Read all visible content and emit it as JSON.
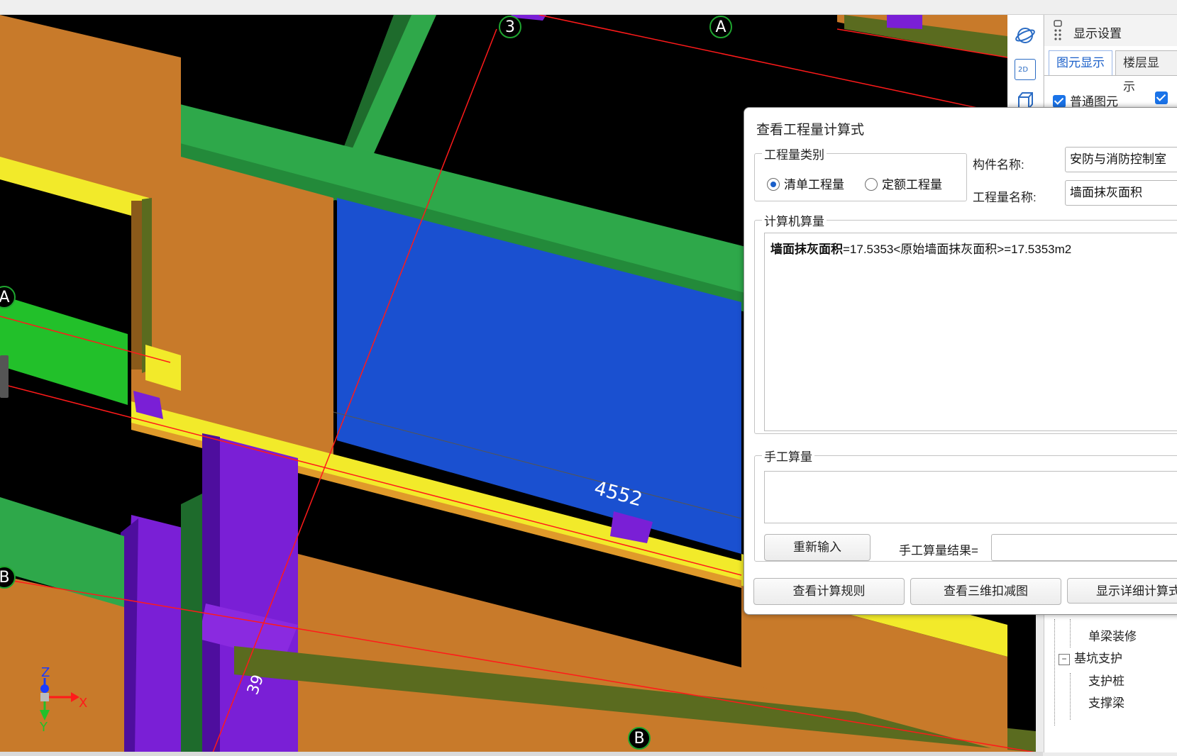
{
  "viewport": {
    "axis_labels": [
      "3",
      "A",
      "A",
      "B",
      "B"
    ],
    "dimension_label": "4552",
    "small_label": "39",
    "gizmo": {
      "x": "X",
      "y": "Y",
      "z": "Z"
    }
  },
  "toolbar": {
    "tools": [
      "orbit-icon",
      "2d-view-icon",
      "3d-box-icon"
    ],
    "view_2d_label": "2D"
  },
  "sidepanel": {
    "title": "显示设置",
    "tabs": {
      "element_display": "图元显示",
      "floor_display": "楼层显示"
    },
    "checkbox_normal": "普通图元",
    "tree": {
      "beam_decoration": "单梁装修",
      "pit_support": "基坑支护",
      "support_pile": "支护桩",
      "support_beam": "支撑梁"
    }
  },
  "dialog": {
    "title": "查看工程量计算式",
    "quantity_type_legend": "工程量类别",
    "radio_list_quantity": "清单工程量",
    "radio_quota_quantity": "定额工程量",
    "component_name_label": "构件名称:",
    "component_name_value": "安防与消防控制室",
    "quantity_name_label": "工程量名称:",
    "quantity_name_value": "墙面抹灰面积",
    "computer_calc_legend": "计算机算量",
    "formula_bold": "墙面抹灰面积",
    "formula_rest": "=17.5353<原始墙面抹灰面积>=17.5353m2",
    "manual_calc_legend": "手工算量",
    "reenter_button": "重新输入",
    "manual_result_label": "手工算量结果=",
    "view_rules_button": "查看计算规则",
    "view_3d_deduction_button": "查看三维扣减图",
    "show_detail_button": "显示详细计算式"
  }
}
